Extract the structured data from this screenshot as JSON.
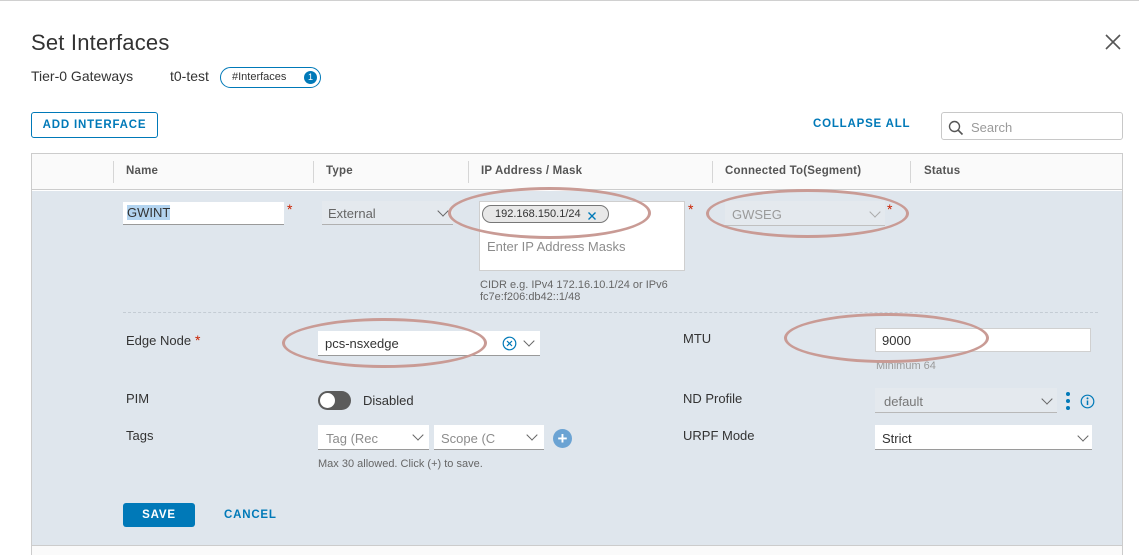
{
  "dialog": {
    "title": "Set Interfaces",
    "breadcrumb": {
      "gateway_type": "Tier-0 Gateways",
      "gateway_name": "t0-test"
    },
    "interfaces_pill": {
      "label": "#Interfaces",
      "count": "1"
    }
  },
  "toolbar": {
    "add_interface_label": "ADD INTERFACE",
    "collapse_all_label": "COLLAPSE ALL",
    "search_placeholder": "Search"
  },
  "grid": {
    "columns": [
      "Name",
      "Type",
      "IP Address / Mask",
      "Connected To(Segment)",
      "Status"
    ]
  },
  "form": {
    "name_value": "GWINT",
    "type_value": "External",
    "ip_chip": "192.168.150.1/24",
    "ip_placeholder": "Enter IP Address Masks",
    "ip_hint_line1": "CIDR e.g. IPv4 172.16.10.1/24 or IPv6",
    "ip_hint_line2": "fc7e:f206:db42::1/48",
    "segment_value": "GWSEG",
    "edge_node_label": "Edge Node",
    "edge_node_value": "pcs-nsxedge",
    "mtu_label": "MTU",
    "mtu_value": "9000",
    "mtu_hint": "Minimum 64",
    "pim_label": "PIM",
    "pim_state": "Disabled",
    "nd_profile_label": "ND Profile",
    "nd_profile_value": "default",
    "tags_label": "Tags",
    "tag_placeholder": "Tag (Rec",
    "scope_placeholder": "Scope (C",
    "tags_hint": "Max 30 allowed. Click (+) to save.",
    "urpf_label": "URPF Mode",
    "urpf_value": "Strict"
  },
  "actions": {
    "save_label": "SAVE",
    "cancel_label": "CANCEL"
  },
  "colors": {
    "accent": "#0079b8",
    "panel": "#dfe6ed",
    "required": "#c92100",
    "annotation": "#c99b95"
  }
}
